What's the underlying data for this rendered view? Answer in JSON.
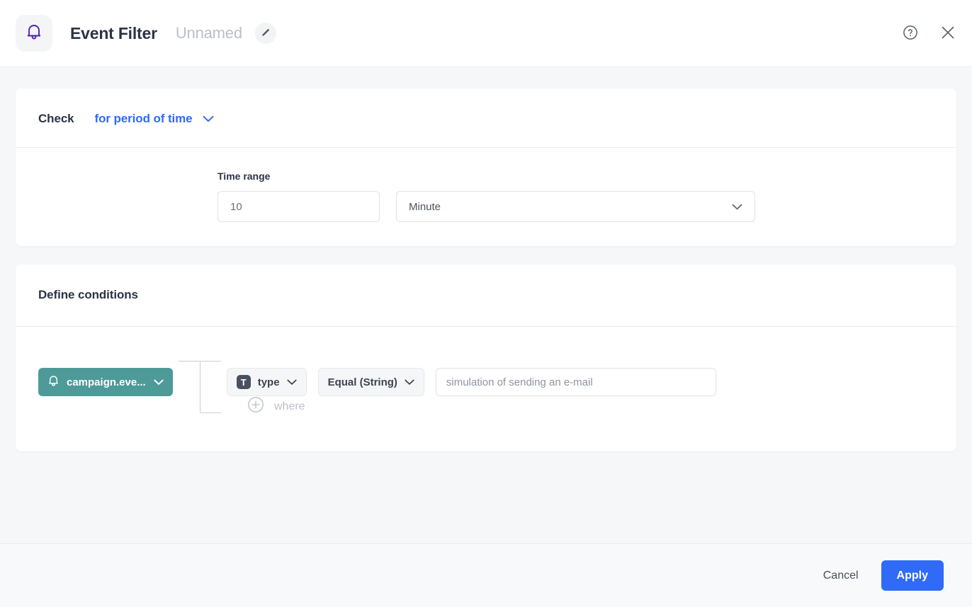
{
  "header": {
    "app_icon": "bell-icon",
    "title": "Event Filter",
    "subtitle": "Unnamed",
    "edit_icon": "pencil-icon",
    "help_icon": "help-circle-icon",
    "close_icon": "close-icon",
    "accent_purple": "#5322b5"
  },
  "check_section": {
    "label": "Check",
    "mode_value": "for period of time",
    "mode_chevron": "chevron-down-icon",
    "accent_blue": "#2f6bf6",
    "time_range": {
      "label": "Time range",
      "amount_value": "10",
      "amount_placeholder": "10",
      "unit_value": "Minute",
      "unit_chevron": "chevron-down-icon"
    }
  },
  "conditions_section": {
    "title": "Define conditions",
    "source": {
      "icon": "bell-icon",
      "label": "campaign.eve...",
      "chevron": "chevron-down-icon",
      "color": "#4d9a99"
    },
    "field": {
      "type_icon_letter": "T",
      "label": "type",
      "chevron": "chevron-down-icon"
    },
    "operator": {
      "label": "Equal (String)",
      "chevron": "chevron-down-icon"
    },
    "value": {
      "text": "simulation of sending an e-mail",
      "placeholder": "simulation of sending an e-mail"
    },
    "add_row": {
      "icon": "plus-circle-icon",
      "label": "where"
    }
  },
  "footer": {
    "cancel_label": "Cancel",
    "apply_label": "Apply",
    "apply_color": "#2f6bf6"
  }
}
